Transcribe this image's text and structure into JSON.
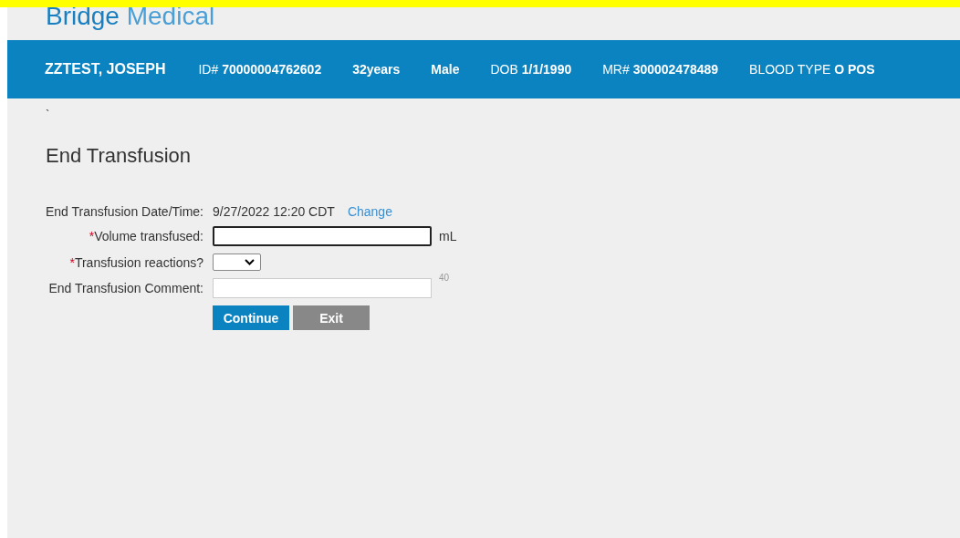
{
  "logo": {
    "brand": "Bridge",
    "product": "Medical"
  },
  "patient_bar": {
    "name": "ZZTEST, JOSEPH",
    "fields": [
      {
        "label": "ID#",
        "value": "70000004762602"
      },
      {
        "value": "32years"
      },
      {
        "value": "Male"
      },
      {
        "label": "DOB",
        "value": "1/1/1990"
      },
      {
        "label": "MR#",
        "value": "300002478489"
      },
      {
        "label": "BLOOD TYPE",
        "value": "O POS"
      }
    ]
  },
  "stray_mark": "`",
  "page_title": "End Transfusion",
  "form": {
    "rows": [
      {
        "kind": "text",
        "label": "End Transfusion Date/Time:",
        "value": "9/27/2022 12:20 CDT",
        "link": "Change"
      },
      {
        "kind": "input",
        "label": "Volume transfused:",
        "required_mark": "*",
        "focused": true,
        "unit": "mL"
      },
      {
        "kind": "select",
        "label": "Transfusion reactions?",
        "required_mark": "*"
      },
      {
        "kind": "input",
        "label": "End Transfusion Comment:",
        "focused": false,
        "counter": "40"
      }
    ],
    "buttons": [
      {
        "label": "Continue",
        "kind": "primary"
      },
      {
        "label": "Exit",
        "kind": "secondary"
      }
    ]
  }
}
